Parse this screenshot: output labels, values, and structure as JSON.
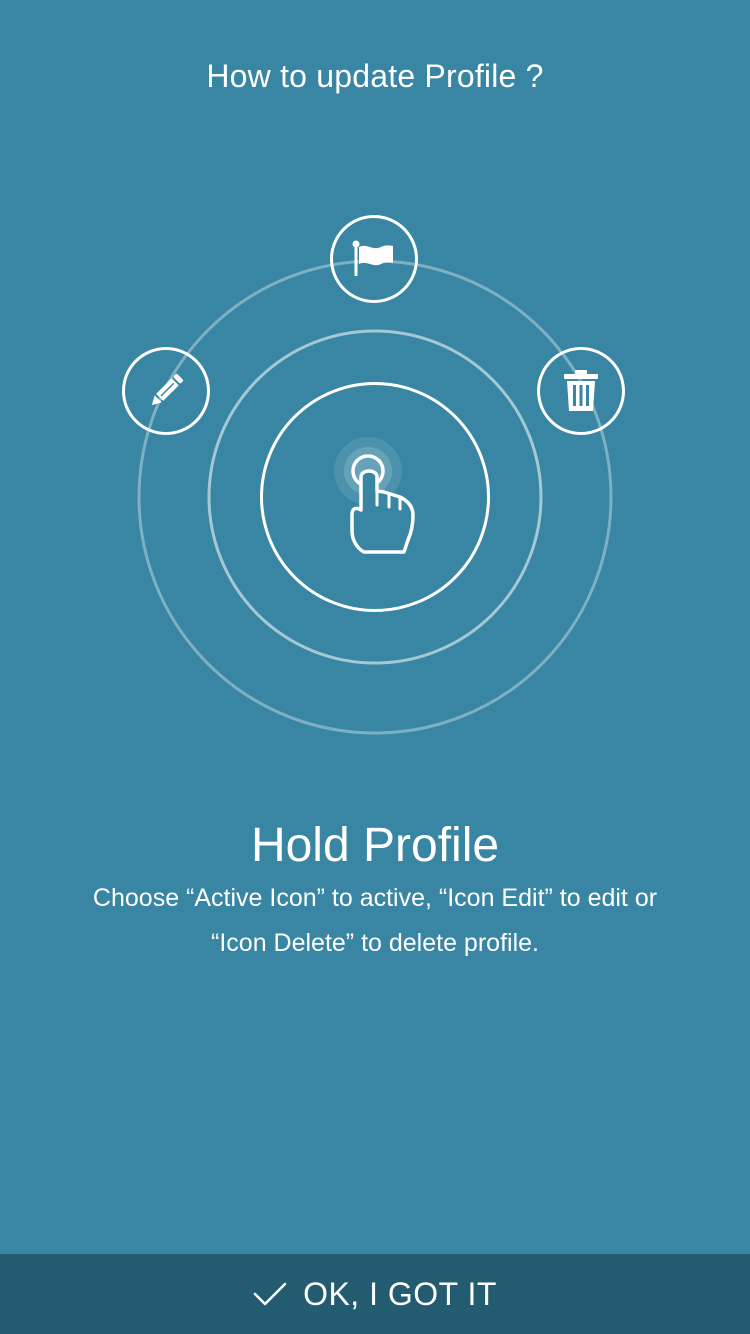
{
  "header": {
    "title": "How to update Profile ?"
  },
  "diagram": {
    "actions": [
      {
        "name": "activate",
        "icon": "flag-icon"
      },
      {
        "name": "edit",
        "icon": "pencil-icon"
      },
      {
        "name": "delete",
        "icon": "trash-icon"
      }
    ],
    "center_icon": "hand-tap-icon"
  },
  "instructions": {
    "title": "Hold Profile",
    "line1": "Choose “Active Icon” to active, “Icon Edit” to edit or",
    "line2": "“Icon Delete” to delete profile."
  },
  "footer": {
    "confirm_label": "OK, I GOT IT",
    "confirm_icon": "checkmark-icon"
  },
  "colors": {
    "background": "#3886a3",
    "footer": "#235c70",
    "foreground": "#ffffff"
  }
}
